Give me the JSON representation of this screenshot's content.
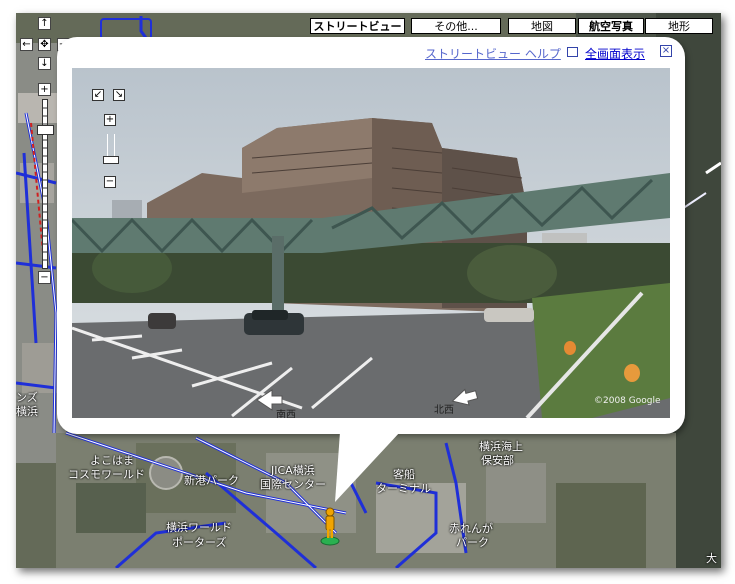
{
  "map_type_buttons": {
    "street_view": "ストリートビュー",
    "more": "その他...",
    "map": "地図",
    "satellite": "航空写真",
    "terrain": "地形"
  },
  "nav_controls": {
    "up": "↑",
    "left": "←",
    "center": "✥",
    "right": "→",
    "down": "↓",
    "zoom_in": "+",
    "zoom_out": "−"
  },
  "bubble": {
    "help_link": "ストリートビュー ヘルプ",
    "fullscreen_link": "全画面表示",
    "close": "×"
  },
  "panorama": {
    "controls": {
      "rotate_left": "↙",
      "rotate_right": "↘",
      "zoom_in": "+",
      "zoom_out": "−"
    },
    "direction_left": "南西",
    "direction_right": "北西",
    "copyright": "©2008 Google"
  },
  "map_labels": {
    "cosmo1": "よこはま",
    "cosmo2": "コスモワールド",
    "jica1": "JICA横浜",
    "jica2": "国際センター",
    "shinko": "新港パーク",
    "terminal1": "客船",
    "terminal2": "ターミナル",
    "coast1": "横浜海上",
    "coast2": "保安部",
    "brick1": "赤れんが",
    "brick2": "パーク",
    "world1": "横浜ワールド",
    "world2": "ポーターズ",
    "left_label": "ンズ",
    "left_label2": "横浜",
    "bottom_right": "大"
  },
  "colors": {
    "road_blue": "#1f2fd8",
    "link_blue": "#0000cc",
    "pegman": "#f0a400"
  }
}
